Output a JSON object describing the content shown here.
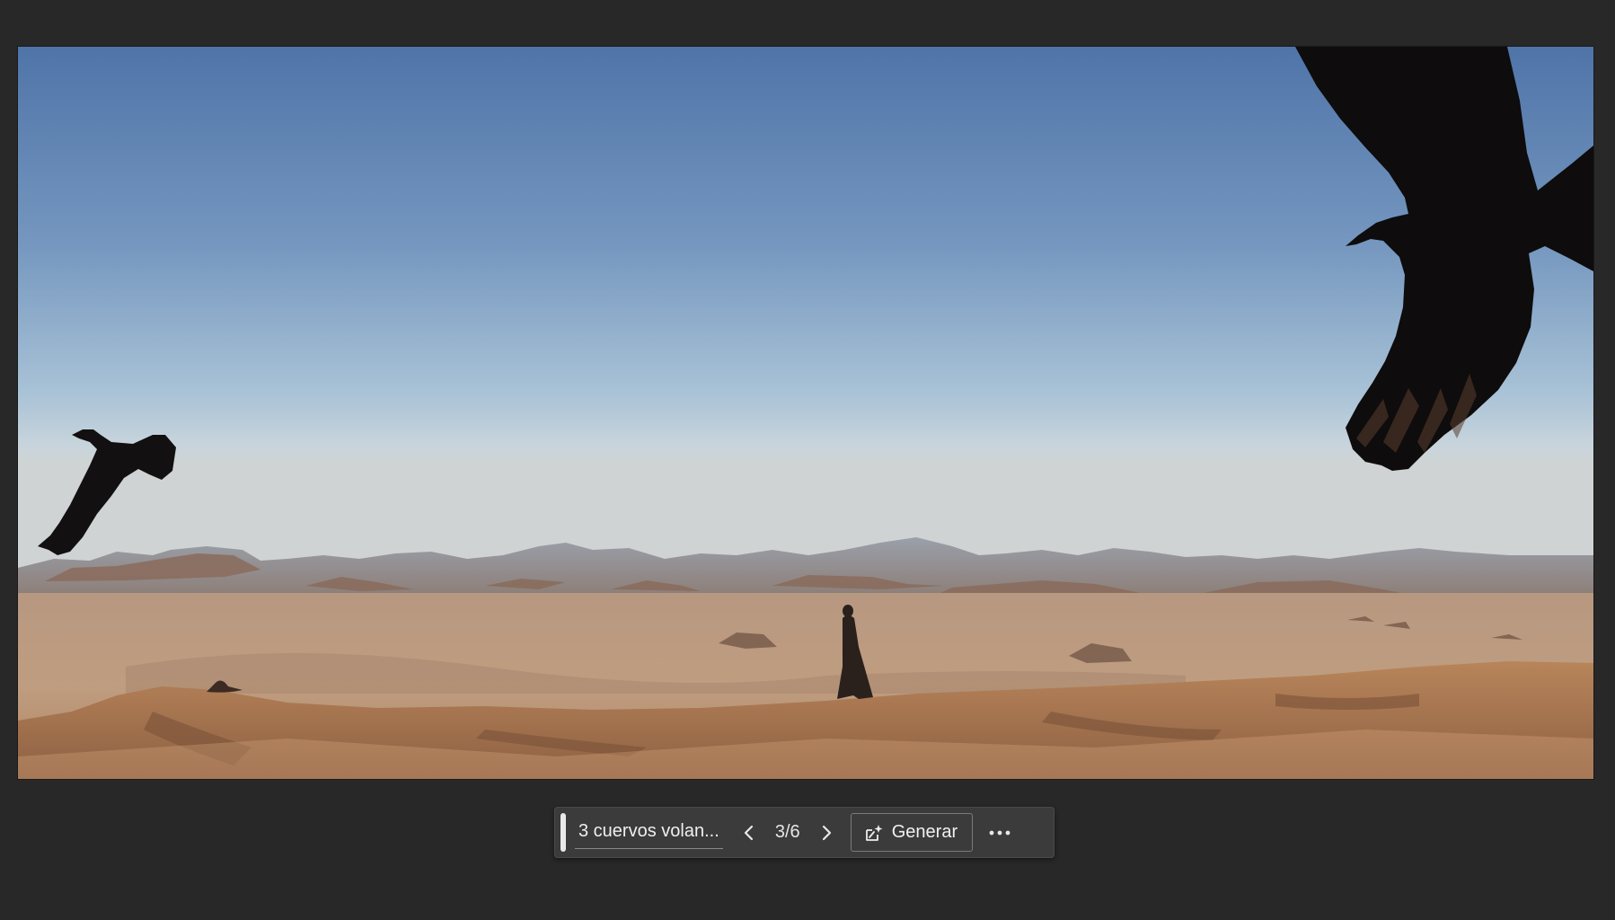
{
  "toolbar": {
    "prompt_text": "3 cuervos volan...",
    "counter": "3/6",
    "generate_label": "Generar",
    "icons": {
      "prev": "chevron-left-icon",
      "next": "chevron-right-icon",
      "generate": "generative-fill-icon",
      "more": "more-options-icon"
    }
  },
  "colors": {
    "app_background": "#282828",
    "toolbar_background": "#3b3b3b",
    "toolbar_text": "#efefef"
  }
}
